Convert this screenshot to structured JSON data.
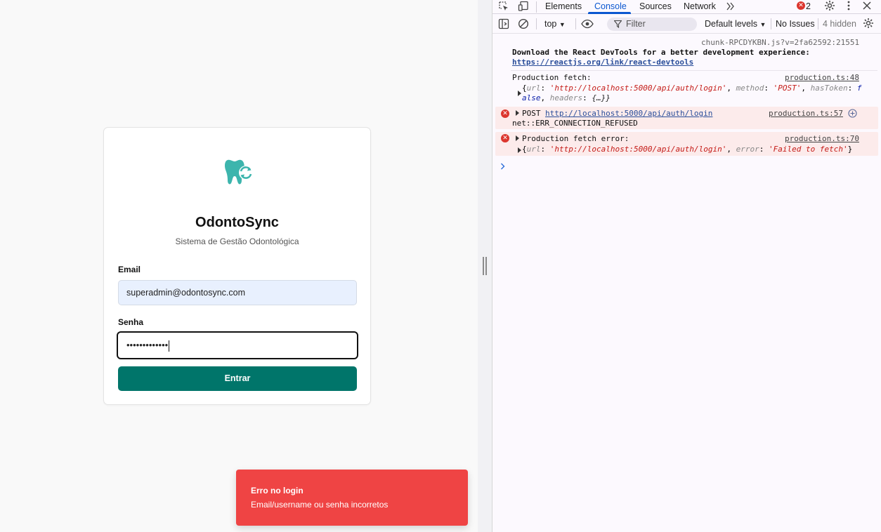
{
  "app": {
    "title": "OdontoSync",
    "subtitle": "Sistema de Gestão Odontológica",
    "email_label": "Email",
    "email_value": "superadmin@odontosync.com",
    "password_label": "Senha",
    "password_masked": "•••••••••••••",
    "submit_label": "Entrar",
    "brand_color": "#00756a",
    "logo_icon": "tooth-sync-icon"
  },
  "toast": {
    "title": "Erro no login",
    "message": "Email/username ou senha incorretos",
    "color": "#ef4444"
  },
  "devtools": {
    "tabs": [
      "Elements",
      "Console",
      "Sources",
      "Network"
    ],
    "active_tab": "Console",
    "error_count": "2",
    "context": "top",
    "filter_placeholder": "Filter",
    "levels": "Default levels",
    "issues": "No Issues",
    "hidden": "4 hidden",
    "accent": "#0b57d0"
  },
  "console": {
    "msg1_source": "chunk-RPCDYKBN.js?v=2fa62592:21551",
    "msg1_text": "Download the React DevTools for a better development experience:",
    "msg1_link": "https://reactjs.org/link/react-devtools",
    "msg2_text": "Production fetch:",
    "msg2_source": "production.ts:48",
    "msg2_obj_open": "{",
    "msg2_k_url": "url",
    "msg2_v_url": "'http://localhost:5000/api/auth/login'",
    "msg2_k_method": "method",
    "msg2_v_method": "'POST'",
    "msg2_k_hastoken": "hasToken",
    "msg2_v_hastoken_a": "f",
    "msg2_v_hastoken_b": "alse",
    "msg2_k_headers": "headers",
    "msg2_v_headers": "{…}}",
    "err1_method": "POST",
    "err1_url": "http://localhost:5000/api/auth/login",
    "err1_source": "production.ts:57",
    "err1_detail": "net::ERR_CONNECTION_REFUSED",
    "err2_text": "Production fetch error:",
    "err2_source": "production.ts:70",
    "err2_k_url": "url",
    "err2_v_url": "'http://localhost:5000/api/auth/login'",
    "err2_k_error": "error",
    "err2_v_error": "'Failed to fetch'"
  }
}
